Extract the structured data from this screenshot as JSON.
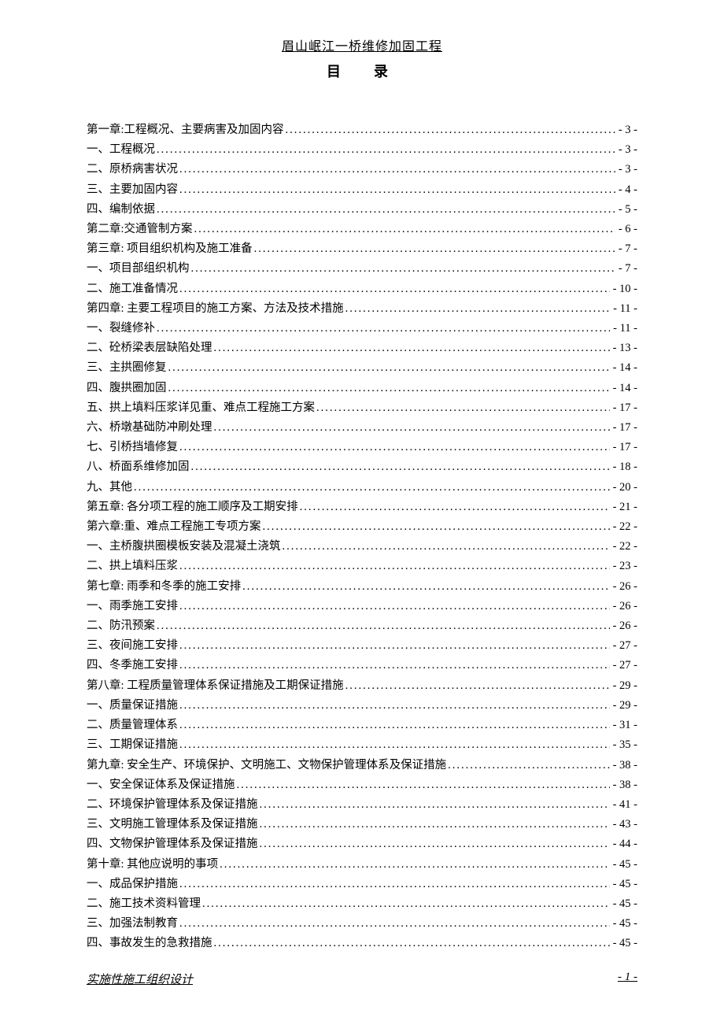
{
  "header": {
    "title": "眉山岷江一桥维修加固工程"
  },
  "toc": {
    "heading": "目　录",
    "entries": [
      {
        "label": "第一章:工程概况、主要病害及加固内容",
        "page": "- 3 -"
      },
      {
        "label": "一、工程概况",
        "page": "- 3 -"
      },
      {
        "label": "二、原桥病害状况",
        "page": "- 3 -"
      },
      {
        "label": "三、主要加固内容",
        "page": "- 4 -"
      },
      {
        "label": "四、编制依据",
        "page": "- 5 -"
      },
      {
        "label": "第二章:交通管制方案",
        "page": "- 6 -"
      },
      {
        "label": "第三章: 项目组织机构及施工准备",
        "page": "- 7 -"
      },
      {
        "label": "一、项目部组织机构",
        "page": "- 7 -"
      },
      {
        "label": "二、施工准备情况",
        "page": "- 10 -"
      },
      {
        "label": "第四章: 主要工程项目的施工方案、方法及技术措施",
        "page": "- 11 -"
      },
      {
        "label": "一、裂缝修补",
        "page": "- 11 -"
      },
      {
        "label": "二、砼桥梁表层缺陷处理",
        "page": "- 13 -"
      },
      {
        "label": "三、主拱圈修复",
        "page": "- 14 -"
      },
      {
        "label": "四、腹拱圈加固",
        "page": "- 14 -"
      },
      {
        "label": "五、拱上填料压浆详见重、难点工程施工方案",
        "page": "- 17 -"
      },
      {
        "label": "六、桥墩基础防冲刷处理",
        "page": "- 17 -"
      },
      {
        "label": "七、引桥挡墙修复",
        "page": "- 17 -"
      },
      {
        "label": "八、桥面系维修加固",
        "page": "- 18 -"
      },
      {
        "label": "九、其他",
        "page": "- 20 -"
      },
      {
        "label": "第五章: 各分项工程的施工顺序及工期安排",
        "page": "- 21 -"
      },
      {
        "label": "第六章:重、难点工程施工专项方案",
        "page": "- 22 -"
      },
      {
        "label": "一、主桥腹拱圈模板安装及混凝土浇筑",
        "page": "- 22 -"
      },
      {
        "label": "二、拱上填料压浆",
        "page": "- 23 -"
      },
      {
        "label": "第七章: 雨季和冬季的施工安排",
        "page": "- 26 -"
      },
      {
        "label": "一、雨季施工安排",
        "page": "- 26 -"
      },
      {
        "label": "二、防汛预案",
        "page": "- 26 -"
      },
      {
        "label": "三、夜间施工安排",
        "page": "- 27 -"
      },
      {
        "label": "四、冬季施工安排",
        "page": "- 27 -"
      },
      {
        "label": "第八章: 工程质量管理体系保证措施及工期保证措施",
        "page": "- 29 -"
      },
      {
        "label": "一、质量保证措施",
        "page": "- 29 -"
      },
      {
        "label": "二、质量管理体系",
        "page": "- 31 -"
      },
      {
        "label": "三、工期保证措施",
        "page": "- 35 -"
      },
      {
        "label": "第九章: 安全生产、环境保护、文明施工、文物保护管理体系及保证措施",
        "page": "- 38 -"
      },
      {
        "label": "一、安全保证体系及保证措施",
        "page": "- 38 -"
      },
      {
        "label": "二、环境保护管理体系及保证措施",
        "page": "- 41 -"
      },
      {
        "label": "三、文明施工管理体系及保证措施",
        "page": "- 43 -"
      },
      {
        "label": "四、文物保护管理体系及保证措施",
        "page": "- 44 -"
      },
      {
        "label": "第十章: 其他应说明的事项",
        "page": "- 45 -"
      },
      {
        "label": "一、成品保护措施",
        "page": "- 45 -"
      },
      {
        "label": "二、施工技术资料管理",
        "page": "- 45 -"
      },
      {
        "label": "三、加强法制教育",
        "page": "- 45 -"
      },
      {
        "label": "四、事故发生的急救措施",
        "page": "- 45 -"
      }
    ]
  },
  "footer": {
    "left": "实施性施工组织设计",
    "right": "- 1 -"
  }
}
